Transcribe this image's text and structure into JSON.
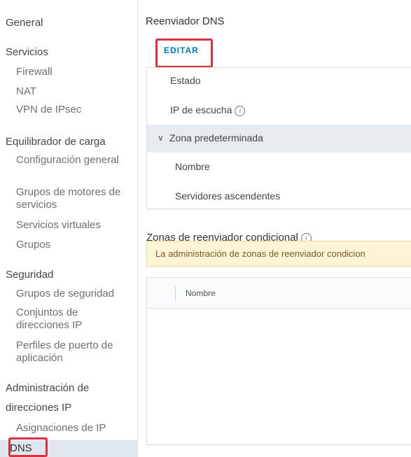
{
  "sidebar": {
    "general": "General",
    "servicios": "Servicios",
    "firewall": "Firewall",
    "nat": "NAT",
    "vpn": "VPN de IPsec",
    "lb": "Equilibrador de carga",
    "config": "Configuración general",
    "grupos_motores": "Grupos de motores de servicios",
    "servicios_virtuales": "Servicios virtuales",
    "grupos": "Grupos",
    "seguridad": "Seguridad",
    "grupos_seguridad": "Grupos de seguridad",
    "conjuntos_ip": "Conjuntos de direcciones IP",
    "perfiles": "Perfiles de puerto de aplicación",
    "admin_ip_1": "Administración de",
    "admin_ip_2": "direcciones IP",
    "asignaciones": "Asignaciones de IP",
    "dns": "DNS"
  },
  "main": {
    "title": "Reenviador DNS",
    "edit": "EDITAR",
    "estado": "Estado",
    "ip_escucha": "IP de escucha",
    "zona_pred": "Zona predeterminada",
    "nombre": "Nombre",
    "servidores": "Servidores ascendentes",
    "zonas_cond": "Zonas de reenviador condicional",
    "banner": "La administración de zonas de reenviador condicion",
    "col_nombre": "Nombre"
  },
  "icons": {
    "info": "info-icon",
    "chevron": "chevron-down-icon"
  },
  "colors": {
    "accent": "#0079b8",
    "highlight_box": "#d7323f",
    "active_bg": "#dfe6ee",
    "banner_bg": "#fdf4d6"
  }
}
